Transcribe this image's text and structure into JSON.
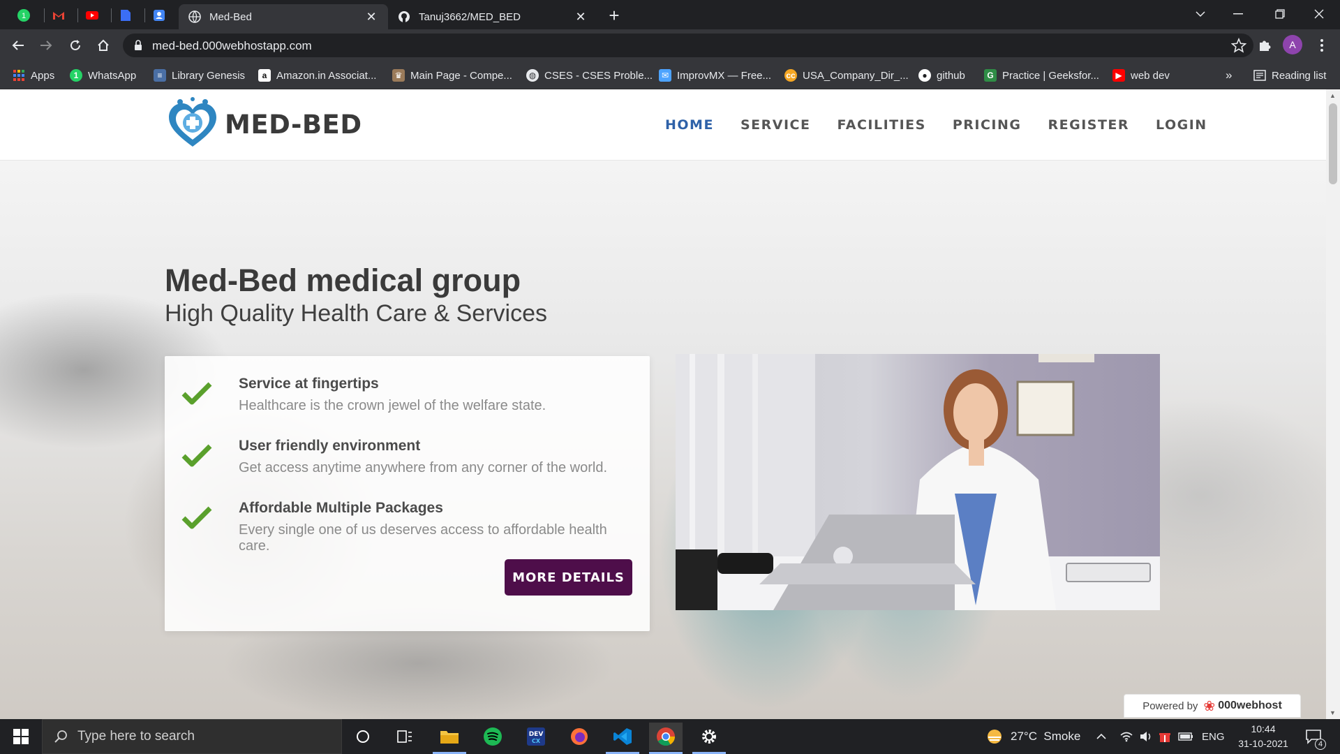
{
  "browser": {
    "tabs": [
      {
        "title": "Med-Bed",
        "active": true
      },
      {
        "title": "Tanuj3662/MED_BED",
        "active": false
      }
    ],
    "address": "med-bed.000webhostapp.com",
    "profile_initial": "A",
    "bookmarks": [
      {
        "label": "Apps",
        "icon": "apps-grid-icon"
      },
      {
        "label": "WhatsApp",
        "icon": "whatsapp-icon",
        "color": "#25d366"
      },
      {
        "label": "Library Genesis",
        "icon": "book-icon",
        "color": "#4a6fa5"
      },
      {
        "label": "Amazon.in Associat...",
        "icon": "amazon-icon",
        "color": "#ffffff"
      },
      {
        "label": "Main Page - Compe...",
        "icon": "wiki-icon",
        "color": "#9b7b5a"
      },
      {
        "label": "CSES - CSES Proble...",
        "icon": "globe-icon",
        "color": "#e8eaed"
      },
      {
        "label": "ImprovMX — Free...",
        "icon": "improvmx-icon",
        "color": "#4da3ff"
      },
      {
        "label": "USA_Company_Dir_...",
        "icon": "cc-icon",
        "color": "#f5a623"
      },
      {
        "label": "github",
        "icon": "github-icon",
        "color": "#ffffff"
      },
      {
        "label": "Practice | Geeksfor...",
        "icon": "gfg-icon",
        "color": "#2f8d46"
      },
      {
        "label": "web dev",
        "icon": "youtube-icon",
        "color": "#ff0000"
      }
    ],
    "overflow_label": "»",
    "reading_list": "Reading list"
  },
  "site": {
    "logo_text": "MED-BED",
    "nav": [
      {
        "label": "HOME",
        "active": true
      },
      {
        "label": "SERVICE",
        "active": false
      },
      {
        "label": "FACILITIES",
        "active": false
      },
      {
        "label": "PRICING",
        "active": false
      },
      {
        "label": "REGISTER",
        "active": false
      },
      {
        "label": "LOGIN",
        "active": false
      }
    ],
    "hero": {
      "title": "Med-Bed medical group",
      "subtitle": "High Quality Health Care & Services",
      "features": [
        {
          "title": "Service at fingertips",
          "desc": "Healthcare is the crown jewel of the welfare state."
        },
        {
          "title": "User friendly environment",
          "desc": "Get access anytime anywhere from any corner of the world."
        },
        {
          "title": "Affordable Multiple Packages",
          "desc": "Every single one of us deserves access to affordable health care."
        }
      ],
      "button": "MORE DETAILS"
    },
    "powered_by": "Powered by",
    "powered_brand": "000webhost",
    "colors": {
      "nav_active": "#2e61a8",
      "button": "#4e0e4a",
      "check": "#5aa02c",
      "logo_blue": "#2e86c1"
    }
  },
  "taskbar": {
    "search_placeholder": "Type here to search",
    "weather": "27°C  Smoke",
    "language": "ENG",
    "time": "10:44",
    "date": "31-10-2021",
    "notifications": "4"
  }
}
